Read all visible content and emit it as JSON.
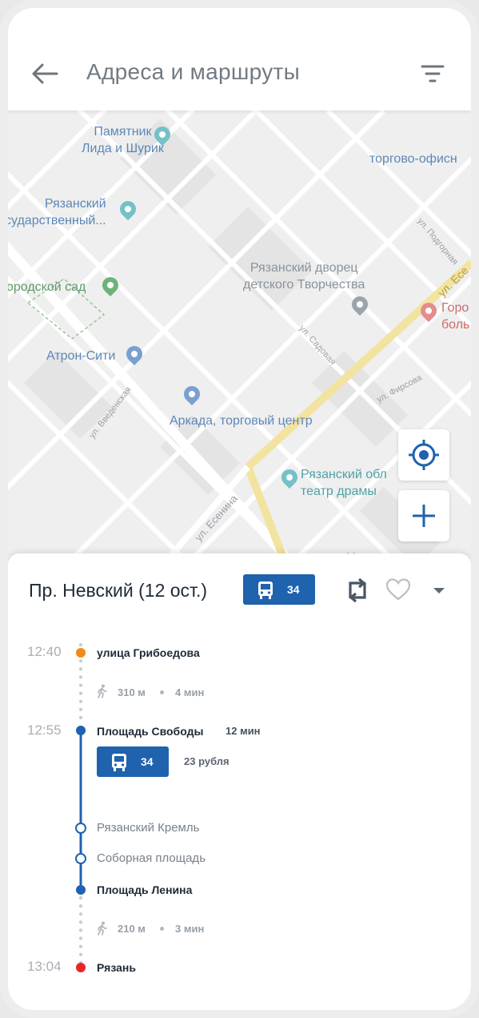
{
  "header": {
    "title": "Адреса и маршруты",
    "back_icon": "arrow-left-icon",
    "filter_icon": "filter-icon"
  },
  "map": {
    "labels": {
      "monument": "Памятник\nЛида и Шурик",
      "office": "торгово-офисн",
      "university": "Рязанский\nсударственный...",
      "palace": "Рязанский дворец\nдетского Творчества",
      "garden": "ородской сад",
      "hospital": "Горо\nболь",
      "atron": "Атрон-Сити",
      "arkada": "Аркада, торговый центр",
      "theatre": "Рязанский обл\nтеатр драмы",
      "center": "Центр за"
    },
    "streets": {
      "podgornaya": "ул. Подгорная",
      "esenina_ne": "ул. Есе",
      "sadovaya": "ул. Садовая",
      "firsova": "ул. Фирсова",
      "vvedenskaya": "ул. Введенская",
      "esenina": "ул. Есенина"
    }
  },
  "route": {
    "title": "Пр. Невский (12 ост.)",
    "bus_number": "34",
    "swap_icon": "swap-icon",
    "favorite_icon": "heart-icon",
    "expand_icon": "chevron-down-icon",
    "start": {
      "time": "12:40",
      "name": "улица Грибоедова"
    },
    "walk1": {
      "distance": "310 м",
      "duration": "4 мин"
    },
    "board": {
      "time": "12:55",
      "name": "Площадь Свободы",
      "ride": "12 мин",
      "bus": "34",
      "price": "23 рубля"
    },
    "stops": [
      "Рязанский Кремль",
      "Соборная площадь"
    ],
    "exit": {
      "name": "Площадь Ленина"
    },
    "walk2": {
      "distance": "210 м",
      "duration": "3 мин"
    },
    "end": {
      "time": "13:04",
      "name": "Рязань"
    }
  },
  "colors": {
    "accent": "#1f62ae",
    "start_dot": "#f08c1a",
    "end_dot": "#e8262a"
  }
}
